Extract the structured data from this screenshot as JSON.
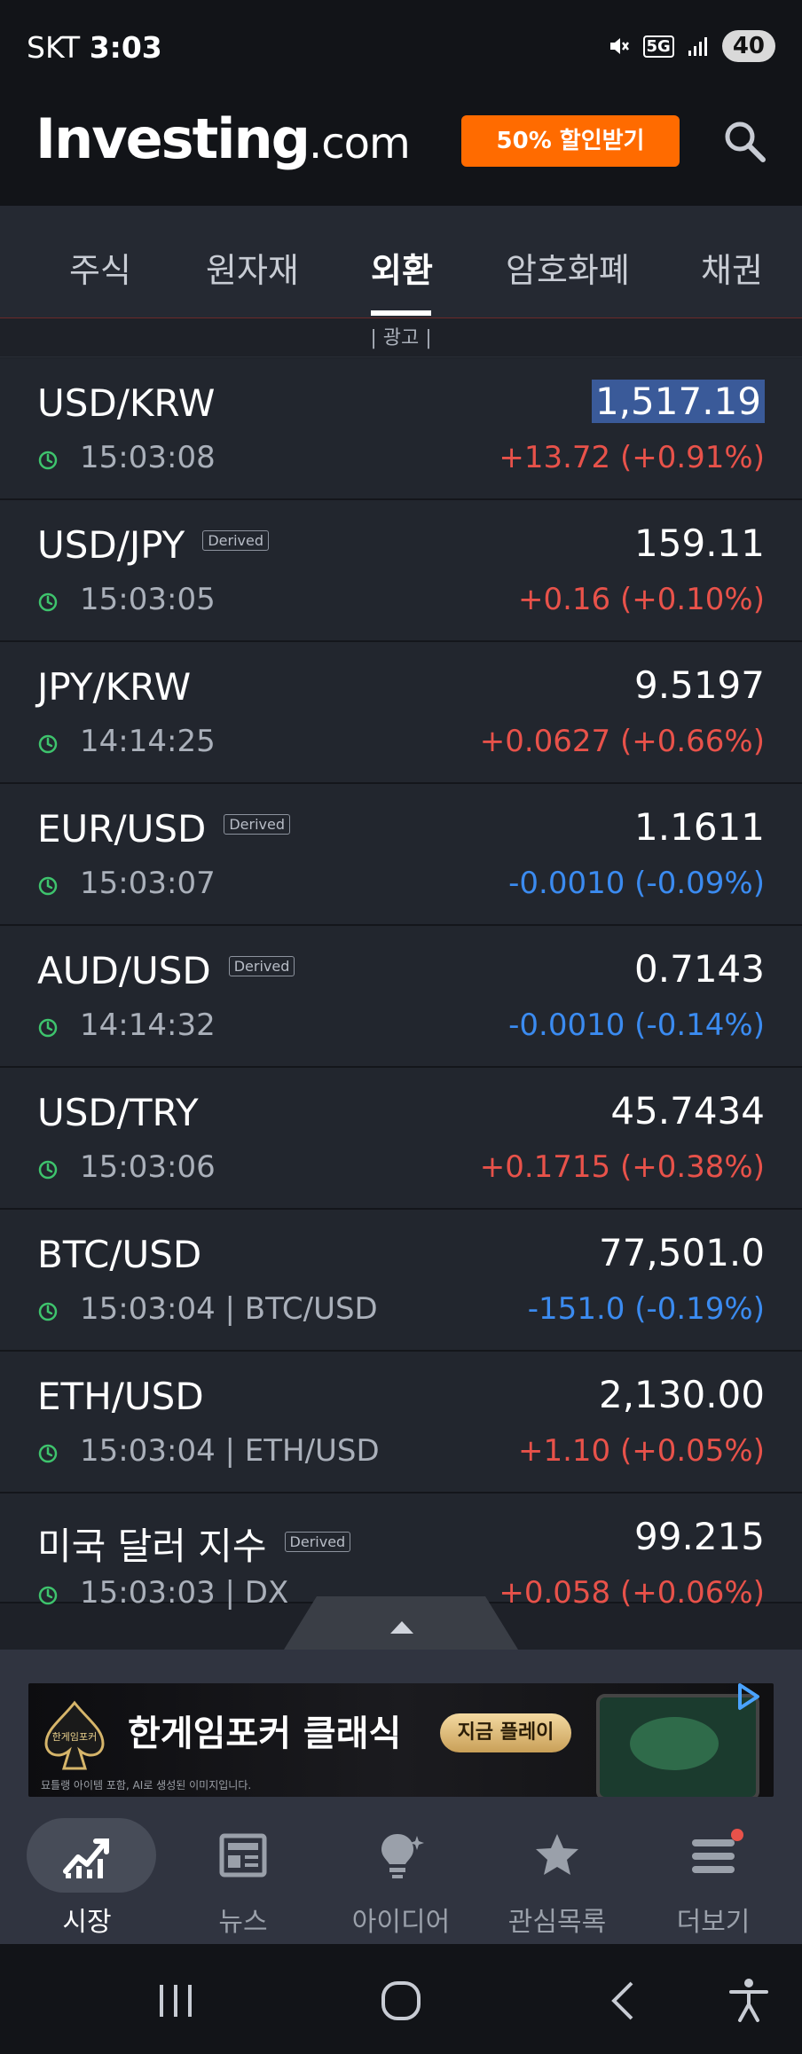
{
  "status_bar": {
    "carrier": "SKT",
    "time": "3:03",
    "network": "5G",
    "battery": "40"
  },
  "header": {
    "logo_brand": "Investing",
    "logo_suffix": ".com",
    "promo_label": "50% 할인받기"
  },
  "tabs": [
    {
      "label": "주식",
      "active": false
    },
    {
      "label": "원자재",
      "active": false
    },
    {
      "label": "외환",
      "active": true
    },
    {
      "label": "암호화폐",
      "active": false
    },
    {
      "label": "채권",
      "active": false
    }
  ],
  "ad_label": "| 광고 |",
  "badge_label": "Derived",
  "colors": {
    "up": "#e8524a",
    "down": "#3b8bf0",
    "clock": "#3ec46d",
    "accent": "#ff6b00",
    "background": "#1e2128"
  },
  "quotes": [
    {
      "name": "USD/KRW",
      "derived": false,
      "time": "15:03:08",
      "price": "1,517.19",
      "change": "+13.72 (+0.91%)",
      "direction": "up",
      "highlighted": true
    },
    {
      "name": "USD/JPY",
      "derived": true,
      "time": "15:03:05",
      "price": "159.11",
      "change": "+0.16 (+0.10%)",
      "direction": "up",
      "highlighted": false
    },
    {
      "name": "JPY/KRW",
      "derived": false,
      "time": "14:14:25",
      "price": "9.5197",
      "change": "+0.0627 (+0.66%)",
      "direction": "up",
      "highlighted": false
    },
    {
      "name": "EUR/USD",
      "derived": true,
      "time": "15:03:07",
      "price": "1.1611",
      "change": "-0.0010 (-0.09%)",
      "direction": "down",
      "highlighted": false
    },
    {
      "name": "AUD/USD",
      "derived": true,
      "time": "14:14:32",
      "price": "0.7143",
      "change": "-0.0010 (-0.14%)",
      "direction": "down",
      "highlighted": false
    },
    {
      "name": "USD/TRY",
      "derived": false,
      "time": "15:03:06",
      "price": "45.7434",
      "change": "+0.1715 (+0.38%)",
      "direction": "up",
      "highlighted": false
    },
    {
      "name": "BTC/USD",
      "derived": false,
      "time": "15:03:04 | BTC/USD",
      "price": "77,501.0",
      "change": "-151.0 (-0.19%)",
      "direction": "down",
      "highlighted": false
    },
    {
      "name": "ETH/USD",
      "derived": false,
      "time": "15:03:04 | ETH/USD",
      "price": "2,130.00",
      "change": "+1.10 (+0.05%)",
      "direction": "up",
      "highlighted": false
    },
    {
      "name": "미국 달러 지수",
      "derived": true,
      "time": "15:03:03 | DX",
      "price": "99.215",
      "change": "+0.058 (+0.06%)",
      "direction": "up",
      "highlighted": false
    }
  ],
  "ad_banner": {
    "title": "한게임포커 클래식",
    "cta": "지금 플레이",
    "fine_print": "묘틀랭 아이템 포함, AI로 생성된 이미지입니다.",
    "logo_text": "한게임포커"
  },
  "bottom_nav": [
    {
      "label": "시장",
      "icon": "chart-icon",
      "active": true
    },
    {
      "label": "뉴스",
      "icon": "news-icon",
      "active": false
    },
    {
      "label": "아이디어",
      "icon": "idea-icon",
      "active": false
    },
    {
      "label": "관심목록",
      "icon": "star-icon",
      "active": false
    },
    {
      "label": "더보기",
      "icon": "menu-icon",
      "active": false
    }
  ]
}
